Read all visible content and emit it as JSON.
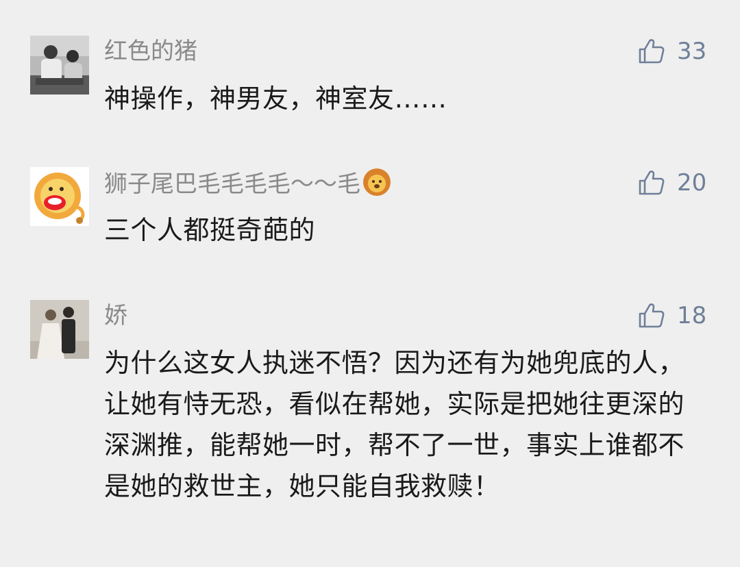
{
  "comments": [
    {
      "avatar": "avatar-photo-men",
      "nickname": "红色的猪",
      "likes": "33",
      "content": "神操作，神男友，神室友……"
    },
    {
      "avatar": "avatar-cartoon-lion",
      "nickname": "狮子尾巴毛毛毛毛～～毛",
      "nickname_emoji": "lion-emoji",
      "likes": "20",
      "content": "三个人都挺奇葩的"
    },
    {
      "avatar": "avatar-photo-couple",
      "nickname": "娇",
      "likes": "18",
      "content": "为什么这女人执迷不悟？因为还有为她兜底的人，让她有恃无恐，看似在帮她，实际是把她往更深的深渊推，能帮她一时，帮不了一世，事实上谁都不是她的救世主，她只能自我救赎！"
    }
  ],
  "colors": {
    "background": "#efefef",
    "nickname": "#8a8a8a",
    "content": "#1a1a1a",
    "like_accent": "#6f7f98"
  },
  "icons": {
    "like": "thumbs-up-icon"
  }
}
